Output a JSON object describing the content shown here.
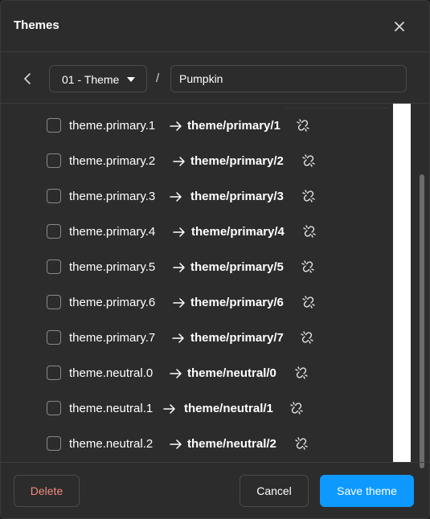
{
  "dialog": {
    "title": "Themes"
  },
  "toolbar": {
    "group_select": "01 - Theme",
    "separator": "/",
    "theme_name": "Pumpkin"
  },
  "rows": [
    {
      "token": "theme.primary.1",
      "path": "theme/primary/1"
    },
    {
      "token": "theme.primary.2",
      "path": "theme/primary/2"
    },
    {
      "token": "theme.primary.3",
      "path": "theme/primary/3"
    },
    {
      "token": "theme.primary.4",
      "path": "theme/primary/4"
    },
    {
      "token": "theme.primary.5",
      "path": "theme/primary/5"
    },
    {
      "token": "theme.primary.6",
      "path": "theme/primary/6"
    },
    {
      "token": "theme.primary.7",
      "path": "theme/primary/7"
    },
    {
      "token": "theme.neutral.0",
      "path": "theme/neutral/0"
    },
    {
      "token": "theme.neutral.1",
      "path": "theme/neutral/1"
    },
    {
      "token": "theme.neutral.2",
      "path": "theme/neutral/2"
    }
  ],
  "row_icons": {
    "arrow": "arrow-right-icon",
    "action": "unlink-icon",
    "checkbox_checked": false
  },
  "footer": {
    "delete_label": "Delete",
    "cancel_label": "Cancel",
    "save_label": "Save theme"
  },
  "colors": {
    "background": "#2c2c2c",
    "accent": "#0d99ff",
    "danger_text": "#f28b82",
    "border": "#4a4a4a"
  }
}
